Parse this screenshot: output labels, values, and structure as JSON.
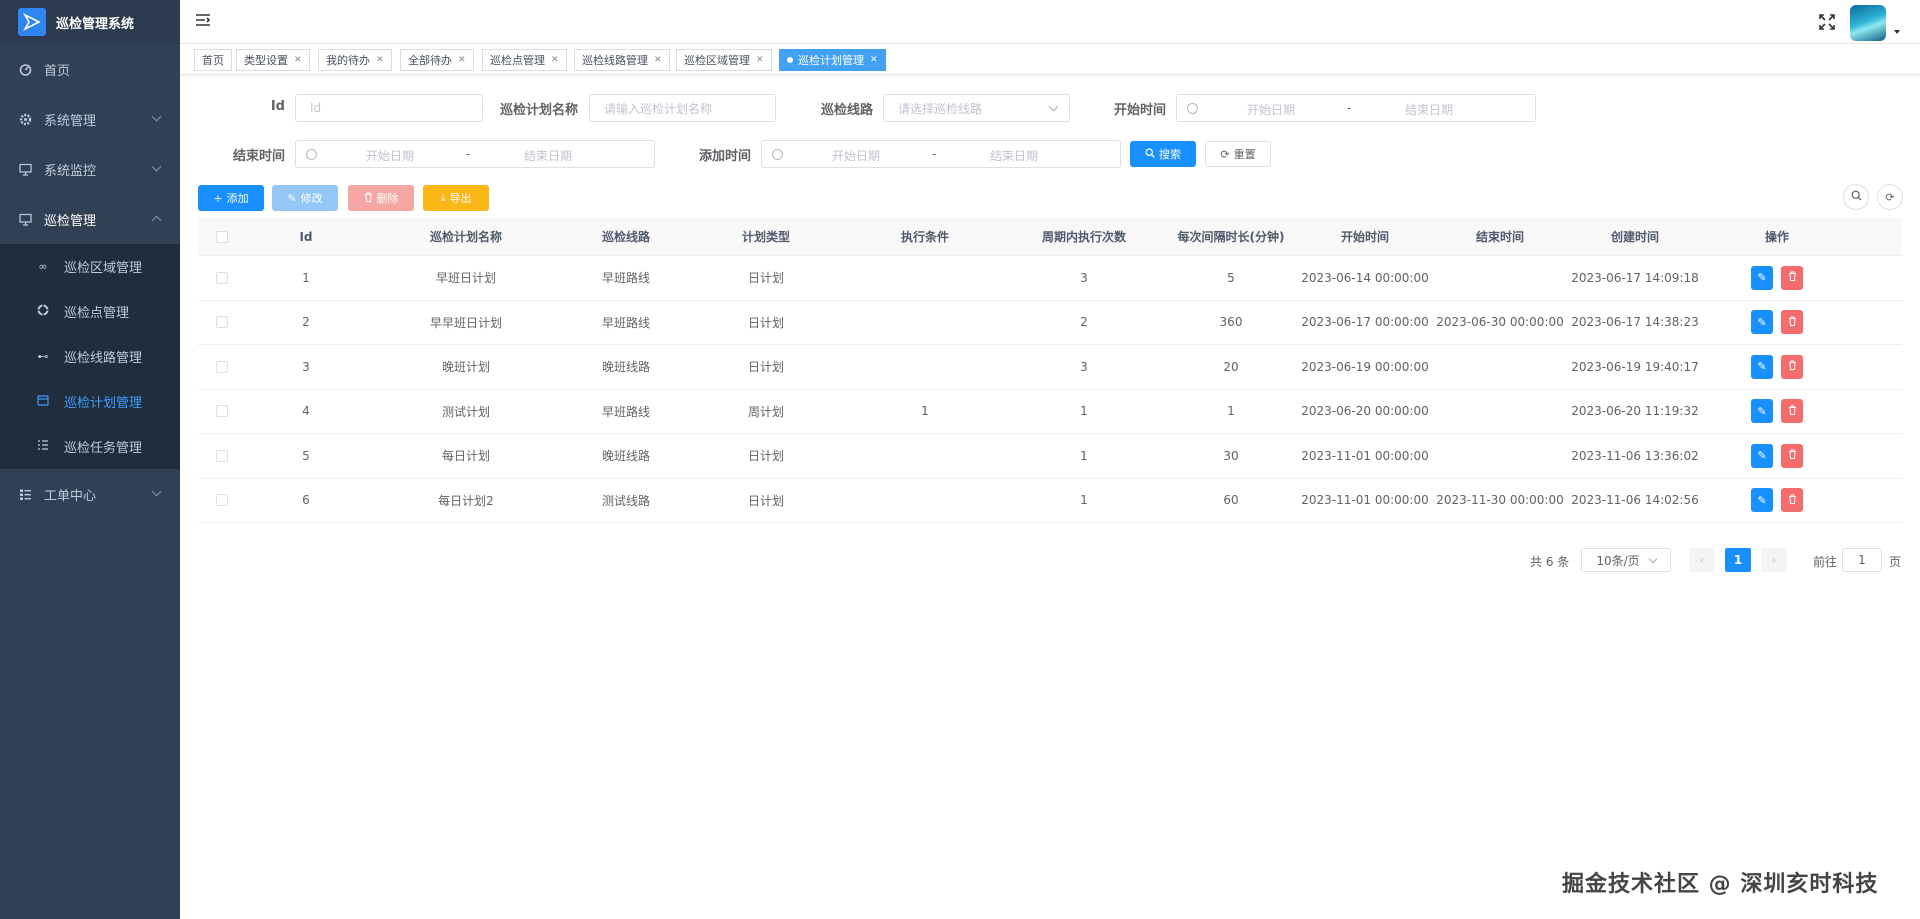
{
  "app": {
    "title": "巡检管理系统"
  },
  "sidebar": {
    "items": [
      {
        "label": "首页",
        "icon": "dashboard-icon"
      },
      {
        "label": "系统管理",
        "icon": "gear-icon"
      },
      {
        "label": "系统监控",
        "icon": "monitor-icon"
      },
      {
        "label": "巡检管理",
        "icon": "monitor-icon"
      },
      {
        "label": "工单中心",
        "icon": "list-icon"
      }
    ],
    "sub_items": [
      {
        "label": "巡检区域管理",
        "icon": "link-icon"
      },
      {
        "label": "巡检点管理",
        "icon": "target-icon"
      },
      {
        "label": "巡检线路管理",
        "icon": "route-icon"
      },
      {
        "label": "巡检计划管理",
        "icon": "calendar-icon"
      },
      {
        "label": "巡检任务管理",
        "icon": "tasks-icon"
      }
    ]
  },
  "tags": [
    {
      "label": "首页"
    },
    {
      "label": "类型设置"
    },
    {
      "label": "我的待办"
    },
    {
      "label": "全部待办"
    },
    {
      "label": "巡检点管理"
    },
    {
      "label": "巡检线路管理"
    },
    {
      "label": "巡检区域管理"
    },
    {
      "label": "巡检计划管理"
    }
  ],
  "search": {
    "id_label": "Id",
    "id_placeholder": "Id",
    "name_label": "巡检计划名称",
    "name_placeholder": "请输入巡检计划名称",
    "route_label": "巡检线路",
    "route_placeholder": "请选择巡检线路",
    "start_label": "开始时间",
    "end_label": "结束时间",
    "add_label": "添加时间",
    "range_start": "开始日期",
    "range_sep": "-",
    "range_end": "结束日期",
    "search_btn": "搜索",
    "reset_btn": "重置"
  },
  "toolbar": {
    "add": "添加",
    "edit": "修改",
    "delete": "删除",
    "export": "导出"
  },
  "table": {
    "headers": [
      "Id",
      "巡检计划名称",
      "巡检线路",
      "计划类型",
      "执行条件",
      "周期内执行次数",
      "每次间隔时长(分钟)",
      "开始时间",
      "结束时间",
      "创建时间",
      "操作"
    ],
    "rows": [
      [
        "1",
        "早班日计划",
        "早班路线",
        "日计划",
        "",
        "3",
        "5",
        "2023-06-14 00:00:00",
        "",
        "2023-06-17 14:09:18"
      ],
      [
        "2",
        "早早班日计划",
        "早班路线",
        "日计划",
        "",
        "2",
        "360",
        "2023-06-17 00:00:00",
        "2023-06-30 00:00:00",
        "2023-06-17 14:38:23"
      ],
      [
        "3",
        "晚班计划",
        "晚班线路",
        "日计划",
        "",
        "3",
        "20",
        "2023-06-19 00:00:00",
        "",
        "2023-06-19 19:40:17"
      ],
      [
        "4",
        "测试计划",
        "早班路线",
        "周计划",
        "1",
        "1",
        "1",
        "2023-06-20 00:00:00",
        "",
        "2023-06-20 11:19:32"
      ],
      [
        "5",
        "每日计划",
        "晚班线路",
        "日计划",
        "",
        "1",
        "30",
        "2023-11-01 00:00:00",
        "",
        "2023-11-06 13:36:02"
      ],
      [
        "6",
        "每日计划2",
        "测试线路",
        "日计划",
        "",
        "1",
        "60",
        "2023-11-01 00:00:00",
        "2023-11-30 00:00:00",
        "2023-11-06 14:02:56"
      ]
    ]
  },
  "pagination": {
    "total": "共 6 条",
    "page_size": "10条/页",
    "current": "1",
    "goto_label": "前往",
    "goto_value": "1",
    "page_unit": "页"
  },
  "watermark": "掘金技术社区 @ 深圳亥时科技",
  "colors": {
    "sidebar": "#304156",
    "primary": "#1890ff",
    "danger": "#f56c6c",
    "warning": "#fbb716"
  }
}
